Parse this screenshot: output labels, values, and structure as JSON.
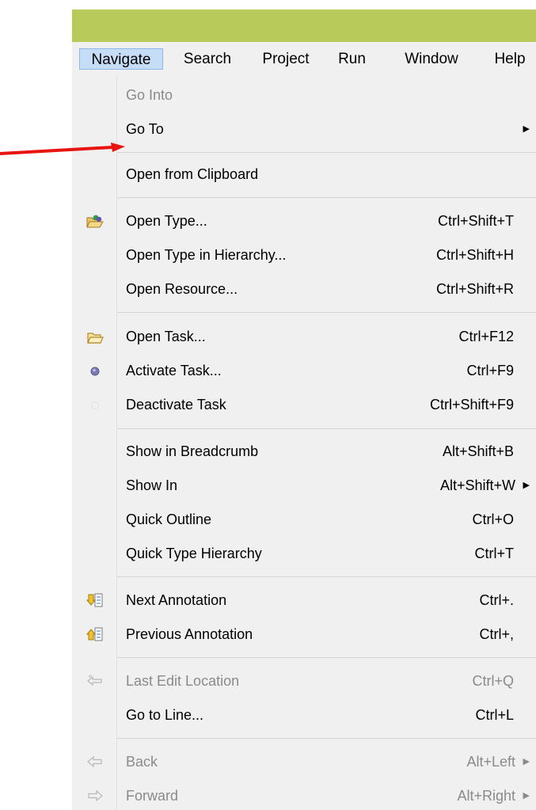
{
  "menubar": {
    "items": [
      {
        "label": "Navigate",
        "active": true
      },
      {
        "label": "Search"
      },
      {
        "label": "Project"
      },
      {
        "label": "Run"
      },
      {
        "label": "Window"
      },
      {
        "label": "Help"
      }
    ]
  },
  "menu": {
    "items": [
      {
        "label": "Go Into",
        "disabled": true
      },
      {
        "label": "Go To",
        "submenu": "▶"
      },
      {
        "label": "Open from Clipboard"
      },
      {
        "label": "Open Type...",
        "accel": "Ctrl+Shift+T",
        "icon": "open-type-icon"
      },
      {
        "label": "Open Type in Hierarchy...",
        "accel": "Ctrl+Shift+H"
      },
      {
        "label": "Open Resource...",
        "accel": "Ctrl+Shift+R"
      },
      {
        "label": "Open Task...",
        "accel": "Ctrl+F12",
        "icon": "open-task-icon"
      },
      {
        "label": "Activate Task...",
        "accel": "Ctrl+F9",
        "icon": "activate-task-icon"
      },
      {
        "label": "Deactivate Task",
        "accel": "Ctrl+Shift+F9",
        "icon": "deactivate-task-icon"
      },
      {
        "label": "Show in Breadcrumb",
        "accel": "Alt+Shift+B"
      },
      {
        "label": "Show In",
        "accel": "Alt+Shift+W",
        "submenu": "▶"
      },
      {
        "label": "Quick Outline",
        "accel": "Ctrl+O"
      },
      {
        "label": "Quick Type Hierarchy",
        "accel": "Ctrl+T"
      },
      {
        "label": "Next Annotation",
        "accel": "Ctrl+.",
        "icon": "next-annotation-icon"
      },
      {
        "label": "Previous Annotation",
        "accel": "Ctrl+,",
        "icon": "previous-annotation-icon"
      },
      {
        "label": "Last Edit Location",
        "accel": "Ctrl+Q",
        "disabled": true,
        "icon": "last-edit-location-icon"
      },
      {
        "label": "Go to Line...",
        "accel": "Ctrl+L"
      },
      {
        "label": "Back",
        "accel": "Alt+Left",
        "submenu": "▶",
        "disabled": true,
        "icon": "back-arrow-icon"
      },
      {
        "label": "Forward",
        "accel": "Alt+Right",
        "submenu": "▶",
        "disabled": true,
        "icon": "forward-arrow-icon"
      }
    ]
  },
  "colors": {
    "titlebar": "#b8ca5a",
    "menu_active": "#c6ddf7",
    "annotation_arrow": "#e8140f"
  }
}
